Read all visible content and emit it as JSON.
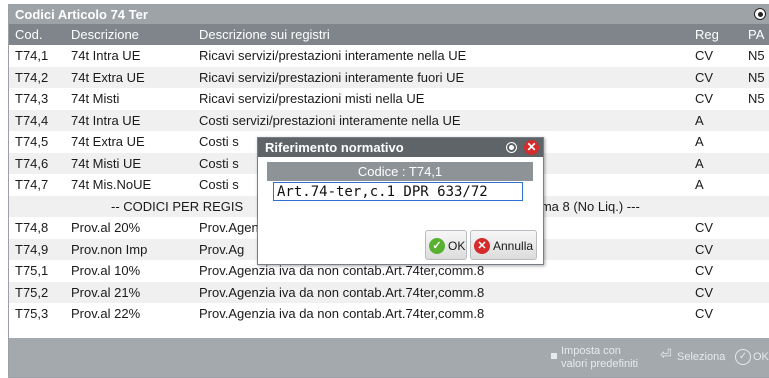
{
  "window": {
    "title": "Codici Articolo 74 Ter"
  },
  "table": {
    "headers": {
      "cod": "Cod.",
      "descrizione": "Descrizione",
      "registri": "Descrizione sui registri",
      "reg": "Reg",
      "pa": "PA"
    },
    "rows": [
      {
        "cod": "T74,1",
        "desc": "74t Intra UE",
        "reg_desc": "Ricavi servizi/prestazioni interamente nella UE",
        "reg": "CV",
        "pa": "N5"
      },
      {
        "cod": "T74,2",
        "desc": "74t Extra UE",
        "reg_desc": "Ricavi servizi/prestazioni interamente fuori UE",
        "reg": "CV",
        "pa": "N5"
      },
      {
        "cod": "T74,3",
        "desc": "74t Misti",
        "reg_desc": "Ricavi servizi/prestazioni misti nella UE",
        "reg": "CV",
        "pa": "N5"
      },
      {
        "cod": "T74,4",
        "desc": "74t Intra UE",
        "reg_desc": "Costi  servizi/prestazioni interamente nella UE",
        "reg": "A",
        "pa": ""
      },
      {
        "cod": "T74,5",
        "desc": "74t Extra UE",
        "reg_desc": "Costi  s",
        "reg": "A",
        "pa": ""
      },
      {
        "cod": "T74,6",
        "desc": "74t Misti UE",
        "reg_desc": "Costi  s",
        "reg": "A",
        "pa": ""
      },
      {
        "cod": "T74,7",
        "desc": "74t Mis.NoUE",
        "reg_desc": "Costi  s",
        "reg": "A",
        "pa": ""
      }
    ],
    "section": {
      "left": "-- CODICI PER REGIS",
      "right": "mma 8 (No Liq.) ---"
    },
    "rows2": [
      {
        "cod": "T74,8",
        "desc": "Prov.al 20%",
        "reg_desc": "Prov.Agen",
        "reg": "CV"
      },
      {
        "cod": "T74,9",
        "desc": "Prov.non Imp",
        "reg_desc": "Prov.Ag",
        "reg": "CV"
      },
      {
        "cod": "T75,1",
        "desc": "Prov.al 10%",
        "reg_desc": "Prov.Agenzia iva da non contab.Art.74ter,comm.8",
        "reg": "CV"
      },
      {
        "cod": "T75,2",
        "desc": "Prov.al 21%",
        "reg_desc": "Prov.Agenzia iva da non contab.Art.74ter,comm.8",
        "reg": "CV"
      },
      {
        "cod": "T75,3",
        "desc": "Prov.al 22%",
        "reg_desc": "Prov.Agenzia iva da non contab.Art.74ter,comm.8",
        "reg": "CV"
      }
    ]
  },
  "footer": {
    "imposta_line1": "Imposta con",
    "imposta_line2": "valori predefiniti",
    "seleziona": "Seleziona",
    "ok_partial": "OK"
  },
  "dialog": {
    "title": "Riferimento normativo",
    "code_label": "Codice : T74,1",
    "value": "Art.74-ter,c.1 DPR 633/72",
    "ok": "OK",
    "annulla": "Annulla"
  },
  "colors": {
    "title_bar": "#9ea3a8",
    "header": "#7f858b",
    "dialog_title": "#5f6469",
    "ok_green": "#58b22f",
    "cancel_red": "#d42b2b",
    "input_border": "#2f6fd6"
  },
  "icons": {
    "window_radio": "radio-icon",
    "dialog_close": "close-icon",
    "ok": "check-icon",
    "cancel": "x-icon",
    "select": "select-icon"
  }
}
